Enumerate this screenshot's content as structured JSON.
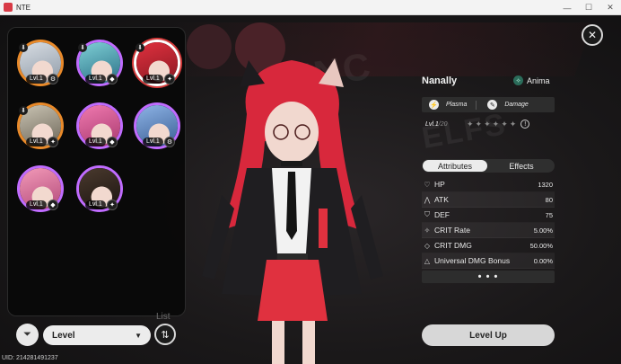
{
  "window": {
    "title": "NTE",
    "controls": {
      "minimize": "—",
      "maximize": "☐",
      "close": "✕"
    }
  },
  "roster": {
    "characters": [
      {
        "level": "Lvl.1",
        "element_icon": "gear-icon",
        "element_glyph": "⚙",
        "ring_color": "#e98a2a",
        "pinned": true,
        "selected": false
      },
      {
        "level": "Lvl.1",
        "element_icon": "drop-icon",
        "element_glyph": "◆",
        "ring_color": "#c06cff",
        "pinned": true,
        "selected": false
      },
      {
        "level": "Lvl.1",
        "element_icon": "anima-icon",
        "element_glyph": "✦",
        "ring_color": "#ffffff",
        "pinned": true,
        "selected": true
      },
      {
        "level": "Lvl.1",
        "element_icon": "star-icon",
        "element_glyph": "✦",
        "ring_color": "#e98a2a",
        "pinned": true,
        "selected": false
      },
      {
        "level": "Lvl.1",
        "element_icon": "drop-icon",
        "element_glyph": "◆",
        "ring_color": "#c06cff",
        "pinned": false,
        "selected": false
      },
      {
        "level": "Lvl.1",
        "element_icon": "gear-icon",
        "element_glyph": "⚙",
        "ring_color": "#c06cff",
        "pinned": false,
        "selected": false
      },
      {
        "level": "Lvl.1",
        "element_icon": "drop-icon",
        "element_glyph": "◆",
        "ring_color": "#c06cff",
        "pinned": false,
        "selected": false
      },
      {
        "level": "Lvl.1",
        "element_icon": "star-icon",
        "element_glyph": "✦",
        "ring_color": "#c06cff",
        "pinned": false,
        "selected": false
      }
    ],
    "list_label": "List"
  },
  "controls": {
    "filter_glyph": "⏷",
    "sort_selected": "Level",
    "sort_caret": "▼",
    "order_glyph": "⇅"
  },
  "uid": "UID: 214281491237",
  "close_glyph": "✕",
  "character": {
    "name": "Nanally",
    "affinity": "Anima",
    "affinity_glyph": "✧",
    "tags": [
      {
        "label": "Plasma",
        "icon_glyph": "⚡"
      },
      {
        "label": "Damage",
        "icon_glyph": "✎"
      }
    ],
    "level_current": "Lvl.1",
    "level_max": "/20",
    "stars_count": 6,
    "info_glyph": "!"
  },
  "tabs": {
    "attributes": "Attributes",
    "effects": "Effects"
  },
  "stats": [
    {
      "name": "HP",
      "value": "1320",
      "glyph": "♡"
    },
    {
      "name": "ATK",
      "value": "80",
      "glyph": "⋀"
    },
    {
      "name": "DEF",
      "value": "75",
      "glyph": "⛉"
    },
    {
      "name": "CRIT Rate",
      "value": "5.00%",
      "glyph": "✧"
    },
    {
      "name": "CRIT DMG",
      "value": "50.00%",
      "glyph": "◇"
    },
    {
      "name": "Universal DMG Bonus",
      "value": "0.00%",
      "glyph": "△"
    }
  ],
  "more_label": "• • •",
  "level_up_label": "Level Up",
  "colors": {
    "accent_red": "#e0313f",
    "hair": "#d8283c",
    "anima": "#2b6c5a",
    "button_light": "#d7d7d7"
  }
}
